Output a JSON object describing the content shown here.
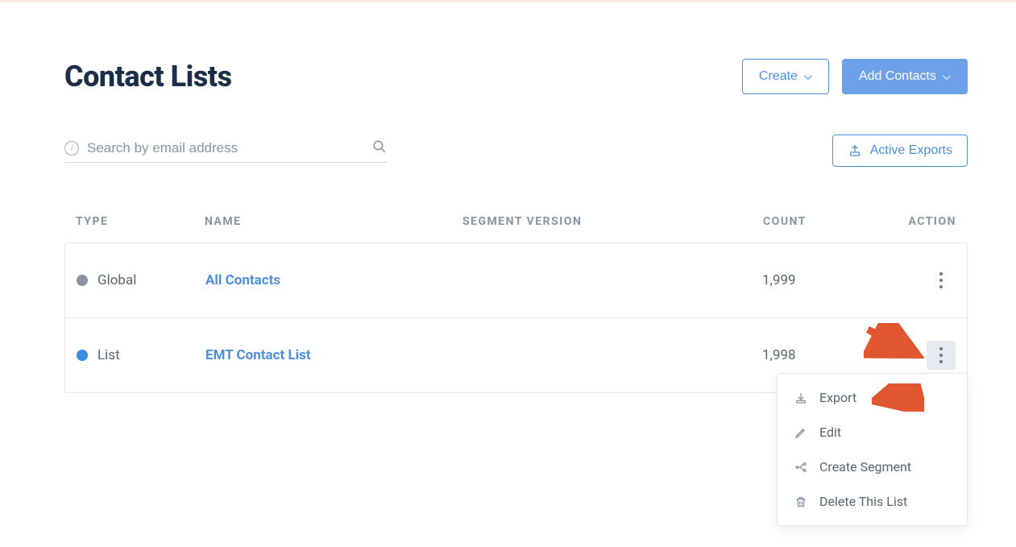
{
  "header": {
    "title": "Contact Lists",
    "create_label": "Create",
    "add_contacts_label": "Add Contacts"
  },
  "search": {
    "placeholder": "Search by email address"
  },
  "exports_button": "Active Exports",
  "table": {
    "headers": {
      "type": "TYPE",
      "name": "NAME",
      "segment_version": "SEGMENT VERSION",
      "count": "COUNT",
      "action": "ACTION"
    },
    "rows": [
      {
        "type_label": "Global",
        "type_color": "gray",
        "name": "All Contacts",
        "segment_version": "",
        "count": "1,999"
      },
      {
        "type_label": "List",
        "type_color": "blue",
        "name": "EMT Contact List",
        "segment_version": "",
        "count": "1,998"
      }
    ]
  },
  "action_menu": {
    "export": "Export",
    "edit": "Edit",
    "create_segment": "Create Segment",
    "delete": "Delete This List"
  }
}
